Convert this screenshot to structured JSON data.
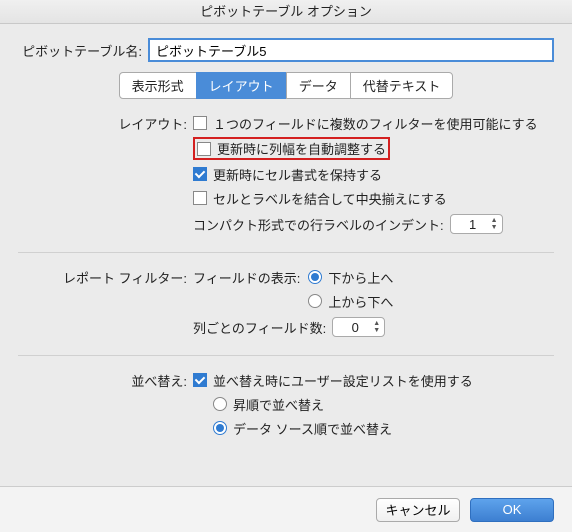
{
  "title": "ピボットテーブル オプション",
  "name_label": "ピボットテーブル名:",
  "name_value": "ピボットテーブル5",
  "tabs": {
    "t0": "表示形式",
    "t1": "レイアウト",
    "t2": "データ",
    "t3": "代替テキスト"
  },
  "layout": {
    "label": "レイアウト:",
    "c0": "１つのフィールドに複数のフィルターを使用可能にする",
    "c1": "更新時に列幅を自動調整する",
    "c2": "更新時にセル書式を保持する",
    "c3": "セルとラベルを結合して中央揃えにする",
    "indent_label": "コンパクト形式での行ラベルのインデント:",
    "indent_value": "1"
  },
  "filter": {
    "label": "レポート フィルター:",
    "show_label": "フィールドの表示:",
    "r0": "下から上へ",
    "r1": "上から下へ",
    "cols_label": "列ごとのフィールド数:",
    "cols_value": "0"
  },
  "sort": {
    "label": "並べ替え:",
    "c0": "並べ替え時にユーザー設定リストを使用する",
    "r0": "昇順で並べ替え",
    "r1": "データ ソース順で並べ替え"
  },
  "buttons": {
    "cancel": "キャンセル",
    "ok": "OK"
  }
}
